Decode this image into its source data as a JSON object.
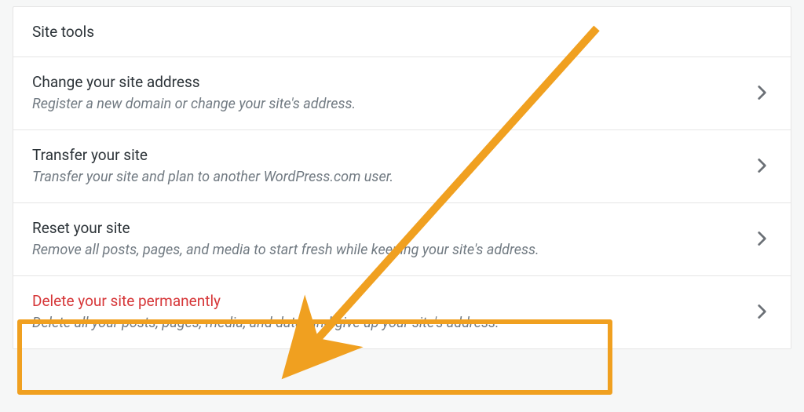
{
  "panel": {
    "header": "Site tools",
    "rows": [
      {
        "title": "Change your site address",
        "subtitle": "Register a new domain or change your site's address.",
        "danger": false
      },
      {
        "title": "Transfer your site",
        "subtitle": "Transfer your site and plan to another WordPress.com user.",
        "danger": false
      },
      {
        "title": "Reset your site",
        "subtitle": "Remove all posts, pages, and media to start fresh while keeping your site's address.",
        "danger": false
      },
      {
        "title": "Delete your site permanently",
        "subtitle": "Delete all your posts, pages, media, and data, and give up your site's address.",
        "danger": true
      }
    ]
  },
  "annotation": {
    "highlight_row_index": 3,
    "color": "#f0a020"
  }
}
